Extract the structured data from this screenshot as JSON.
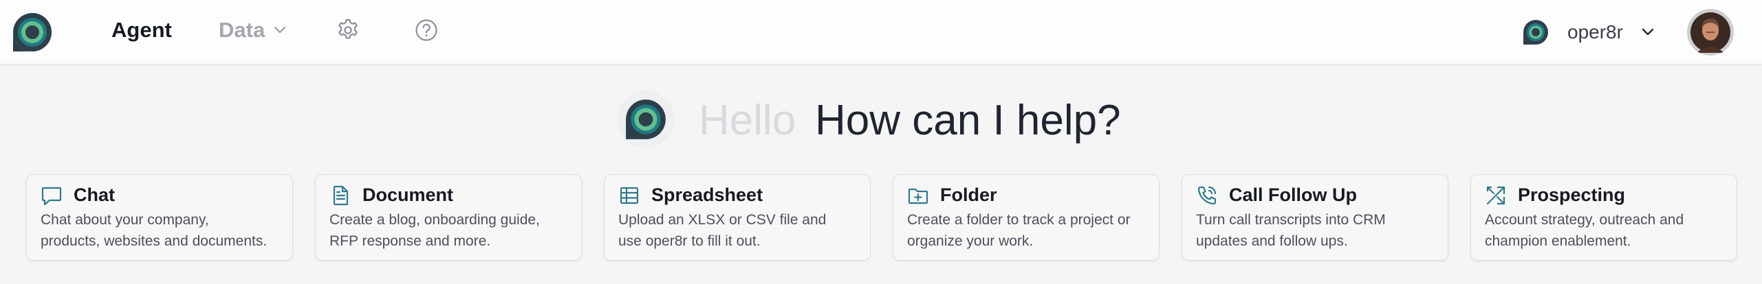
{
  "nav": {
    "agent_label": "Agent",
    "data_label": "Data",
    "settings_icon": "gear-icon",
    "help_icon": "question-circle-icon"
  },
  "user": {
    "workspace_name": "oper8r"
  },
  "hero": {
    "hello": "Hello",
    "question": "How can I help?"
  },
  "cards": [
    {
      "title": "Chat",
      "icon": "chat-bubble-icon",
      "desc_line1": "Chat about your company,",
      "desc_line2": "products, websites and documents."
    },
    {
      "title": "Document",
      "icon": "document-icon",
      "desc_line1": "Create a blog, onboarding guide,",
      "desc_line2": "RFP response and more."
    },
    {
      "title": "Spreadsheet",
      "icon": "table-icon",
      "desc_line1": "Upload an XLSX or CSV file and",
      "desc_line2": "use oper8r to fill it out."
    },
    {
      "title": "Folder",
      "icon": "folder-plus-icon",
      "desc_line1": "Create a folder to track a project or",
      "desc_line2": "organize your work."
    },
    {
      "title": "Call Follow Up",
      "icon": "phone-call-icon",
      "desc_line1": "Turn call transcripts into CRM",
      "desc_line2": "updates and follow ups."
    },
    {
      "title": "Prospecting",
      "icon": "route-arrows-icon",
      "desc_line1": "Account strategy, outreach and",
      "desc_line2": "champion enablement."
    }
  ],
  "colors": {
    "accent": "#2f7a8c",
    "logo_dark": "#2e3f4a",
    "logo_ring": "#1f7a82",
    "logo_mid": "#62bf8f",
    "logo_inner": "#aee3c6"
  }
}
